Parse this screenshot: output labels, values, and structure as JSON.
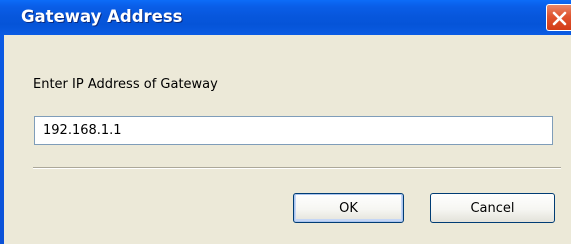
{
  "window": {
    "title": "Gateway Address"
  },
  "dialog": {
    "prompt": "Enter IP Address of Gateway",
    "ip_value": "192.168.1.1",
    "ok_label": "OK",
    "cancel_label": "Cancel"
  },
  "icons": {
    "close": "close-icon"
  },
  "colors": {
    "titlebar": "#0757dd",
    "client_bg": "#ece9d8",
    "close_button": "#e0542f",
    "input_border": "#7f9db9"
  }
}
